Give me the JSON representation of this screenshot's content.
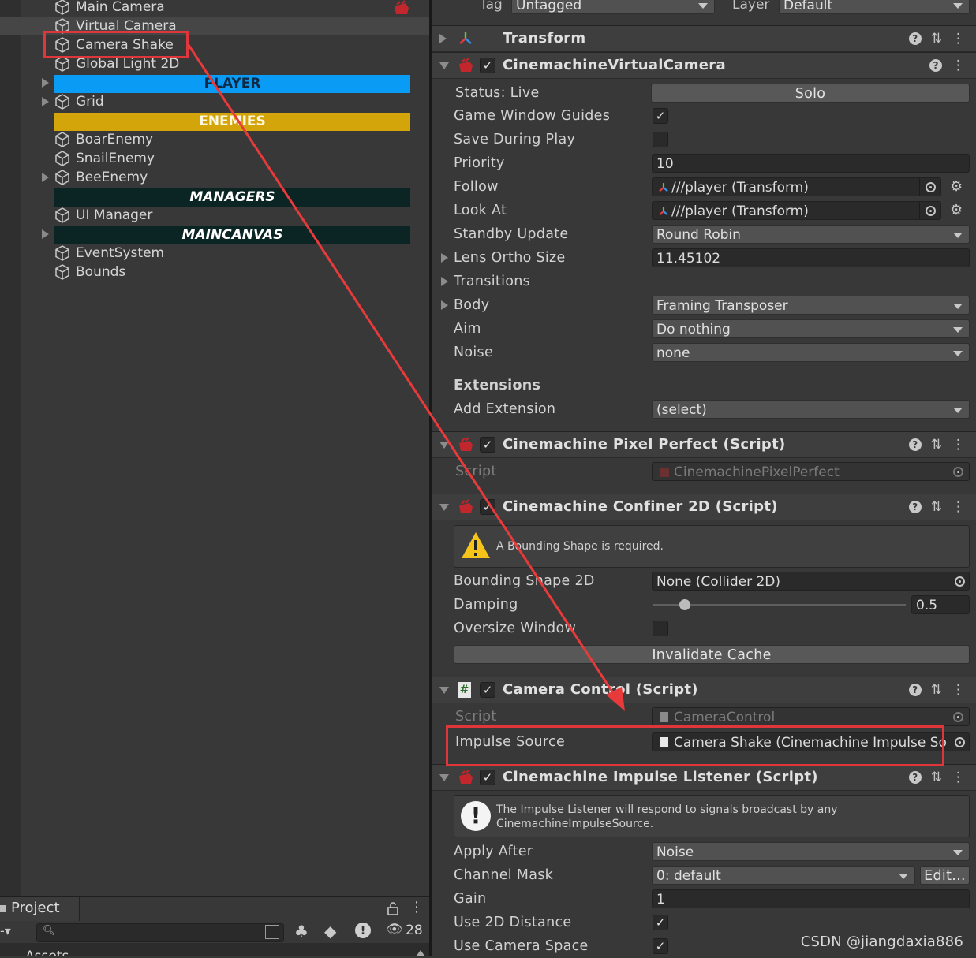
{
  "hierarchy": {
    "items": [
      {
        "label": "Main Camera"
      },
      {
        "label": "Virtual Camera"
      },
      {
        "label": "Camera Shake"
      },
      {
        "label": "Global Light 2D"
      },
      {
        "label": "Grid"
      },
      {
        "label": "BoarEnemy"
      },
      {
        "label": "SnailEnemy"
      },
      {
        "label": "BeeEnemy"
      },
      {
        "label": "UI Manager"
      },
      {
        "label": "EventSystem"
      },
      {
        "label": "Bounds"
      }
    ],
    "banners": [
      {
        "label": "PLAYER",
        "color": "#0a9bf5",
        "text_color": "#0f2a44"
      },
      {
        "label": "ENEMIES",
        "color": "#d4a50a",
        "text_color": "#fff8e0"
      },
      {
        "label": "MANAGERS",
        "color": "#0b2424",
        "text_color": "#ffffff"
      },
      {
        "label": "MAINCANVAS",
        "color": "#0b2424",
        "text_color": "#ffffff"
      }
    ]
  },
  "inspector": {
    "tag_label": "Tag",
    "tag_value": "Untagged",
    "layer_label": "Layer",
    "layer_value": "Default",
    "transform": {
      "title": "Transform"
    },
    "vcam": {
      "title": "CinemachineVirtualCamera",
      "status_label": "Status: Live",
      "solo_button": "Solo",
      "game_window_guides": "Game Window Guides",
      "save_during_play": "Save During Play",
      "priority_label": "Priority",
      "priority_value": "10",
      "follow_label": "Follow",
      "follow_value": "///player (Transform)",
      "look_at_label": "Look At",
      "look_at_value": "///player (Transform)",
      "standby_label": "Standby Update",
      "standby_value": "Round Robin",
      "lens_label": "Lens Ortho Size",
      "lens_value": "11.45102",
      "transitions_label": "Transitions",
      "body_label": "Body",
      "body_value": "Framing Transposer",
      "aim_label": "Aim",
      "aim_value": "Do nothing",
      "noise_label": "Noise",
      "noise_value": "none",
      "extensions_label": "Extensions",
      "add_extension_label": "Add Extension",
      "add_extension_value": "(select)"
    },
    "pixel_perfect": {
      "title": "Cinemachine Pixel Perfect (Script)",
      "script_label": "Script",
      "script_value": "CinemachinePixelPerfect"
    },
    "confiner": {
      "title": "Cinemachine Confiner 2D (Script)",
      "warning": "A Bounding Shape is required.",
      "bounding_label": "Bounding Shape 2D",
      "bounding_value": "None (Collider 2D)",
      "damping_label": "Damping",
      "damping_value": "0.5",
      "damping_fraction": 0.125,
      "oversize_label": "Oversize Window",
      "invalidate_button": "Invalidate Cache"
    },
    "camera_control": {
      "title": "Camera Control (Script)",
      "script_label": "Script",
      "script_value": "CameraControl",
      "impulse_label": "Impulse Source",
      "impulse_value": "Camera Shake (Cinemachine Impulse Source)"
    },
    "impulse_listener": {
      "title": "Cinemachine Impulse Listener (Script)",
      "info_line1": "The Impulse Listener will respond to signals broadcast by any",
      "info_line2": "CinemachineImpulseSource.",
      "apply_after_label": "Apply After",
      "apply_after_value": "Noise",
      "channel_mask_label": "Channel Mask",
      "channel_mask_value": "0: default",
      "edit_button": "Edit...",
      "gain_label": "Gain",
      "gain_value": "1",
      "use_2d_label": "Use 2D Distance",
      "use_camera_space_label": "Use Camera Space"
    }
  },
  "project": {
    "tab_label": "Project",
    "assets_label": "Assets",
    "hidden_count": "28"
  },
  "watermark": "CSDN @jiangdaxia886",
  "colors": {
    "highlight": "#e0353a",
    "arrow": "#e83a3a"
  }
}
